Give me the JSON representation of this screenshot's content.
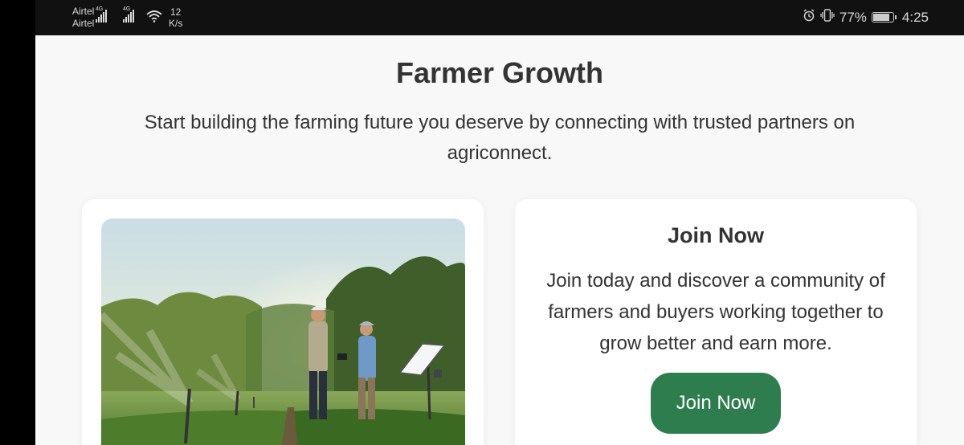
{
  "status_bar": {
    "carrier_1": "Airtel",
    "carrier_2": "Airtel",
    "network_1": "4G",
    "network_2": "4G",
    "speed_value": "12",
    "speed_unit": "K/s",
    "battery": "77%",
    "battery_level": 0.77,
    "time": "4:25",
    "icons": [
      "signal-icon",
      "wifi-icon",
      "alarm-icon",
      "vibrate-icon",
      "battery-icon"
    ]
  },
  "page": {
    "title": "Farmer Growth",
    "subtitle": "Start building the farming future you deserve by connecting with trusted partners on agriconnect."
  },
  "join_card": {
    "title": "Join Now",
    "text": "Join today and discover a community of farmers and buyers working together to grow better and earn more.",
    "button_label": "Join Now"
  },
  "colors": {
    "accent": "#2e7d4f",
    "background": "#f8f8f8",
    "text": "#333333"
  }
}
